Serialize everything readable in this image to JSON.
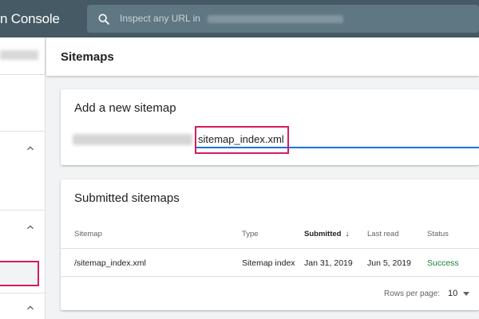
{
  "app": {
    "title": "n Console"
  },
  "search": {
    "placeholder": "Inspect any URL in"
  },
  "page": {
    "title": "Sitemaps"
  },
  "add_sitemap": {
    "title": "Add a new sitemap",
    "input_value": "sitemap_index.xml"
  },
  "submitted": {
    "title": "Submitted sitemaps",
    "columns": {
      "sitemap": "Sitemap",
      "type": "Type",
      "submitted": "Submitted",
      "last_read": "Last read",
      "status": "Status"
    },
    "sort_indicator": "↓",
    "rows": [
      {
        "sitemap": "/sitemap_index.xml",
        "type": "Sitemap index",
        "submitted": "Jan 31, 2019",
        "last_read": "Jun 5, 2019",
        "status": "Success"
      }
    ],
    "footer": {
      "rows_per_page_label": "Rows per page:",
      "rows_per_page_value": "10"
    }
  },
  "colors": {
    "topbar": "#455a64",
    "accent": "#1a73e8",
    "highlight": "#d81b60",
    "success": "#188038"
  },
  "icons": {
    "search": "search-icon",
    "chevron": "chevron-up-icon",
    "dropdown": "caret-down-icon",
    "sort": "arrow-down-icon"
  }
}
